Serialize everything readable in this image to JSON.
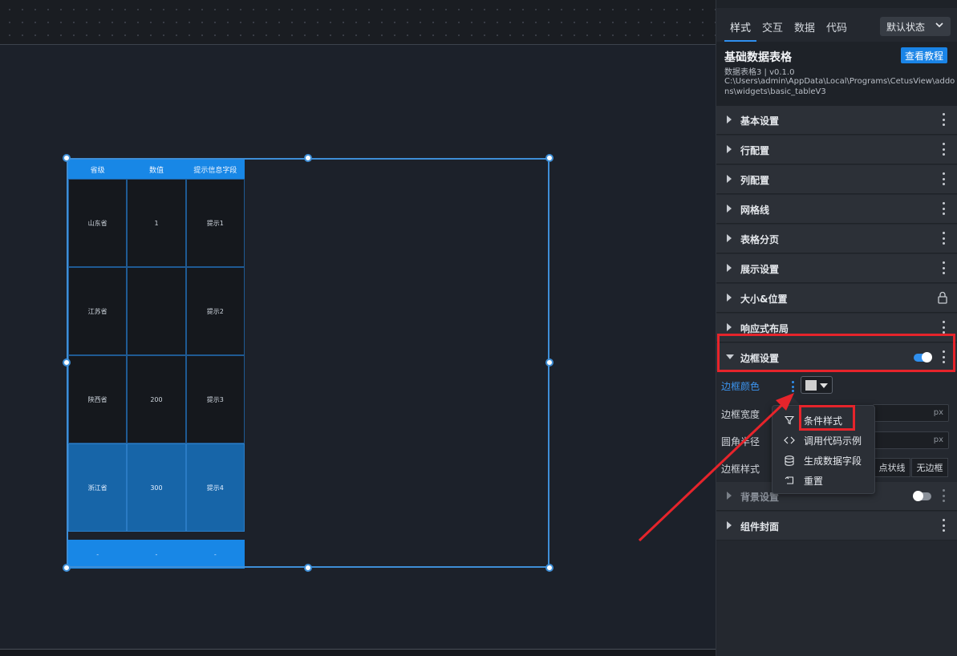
{
  "table": {
    "headers": [
      "省级",
      "数值",
      "提示信息字段"
    ],
    "rows": [
      [
        "山东省",
        "1",
        "提示1"
      ],
      [
        "江苏省",
        "",
        "提示2"
      ],
      [
        "陕西省",
        "200",
        "提示3"
      ],
      [
        "浙江省",
        "300",
        "提示4"
      ]
    ],
    "footer": [
      "-",
      "-",
      "-"
    ]
  },
  "panel": {
    "tabs": [
      "样式",
      "交互",
      "数据",
      "代码"
    ],
    "state_select": "默认状态",
    "widget_name": "基础数据表格",
    "widget_version": "数据表格3 | v0.1.0",
    "widget_path": "C:\\Users\\admin\\AppData\\Local\\Programs\\CetusView\\addons\\widgets\\basic_tableV3",
    "tutorial_button": "查看教程",
    "sections": {
      "basic": "基本设置",
      "row_config": "行配置",
      "col_config": "列配置",
      "grid_lines": "网格线",
      "paging": "表格分页",
      "display": "展示设置",
      "size_position": "大小&位置",
      "responsive": "响应式布局",
      "border": "边框设置",
      "background": "背景设置",
      "cover": "组件封面"
    },
    "border_props": {
      "color_label": "边框颜色",
      "width_label": "边框宽度",
      "radius_label": "圆角半径",
      "style_label": "边框样式",
      "unit": "px",
      "style_options": [
        "点状线",
        "无边框"
      ],
      "color_value": "#cfcfcf"
    },
    "border_toggle_on": true,
    "background_toggle_on": false
  },
  "context_menu": {
    "items": [
      {
        "icon": "filter-icon",
        "label": "条件样式"
      },
      {
        "icon": "code-icon",
        "label": "调用代码示例"
      },
      {
        "icon": "database-icon",
        "label": "生成数据字段"
      },
      {
        "icon": "reset-icon",
        "label": "重置"
      }
    ]
  },
  "colors": {
    "accent": "#1887e6",
    "annotation": "#e6242b"
  }
}
